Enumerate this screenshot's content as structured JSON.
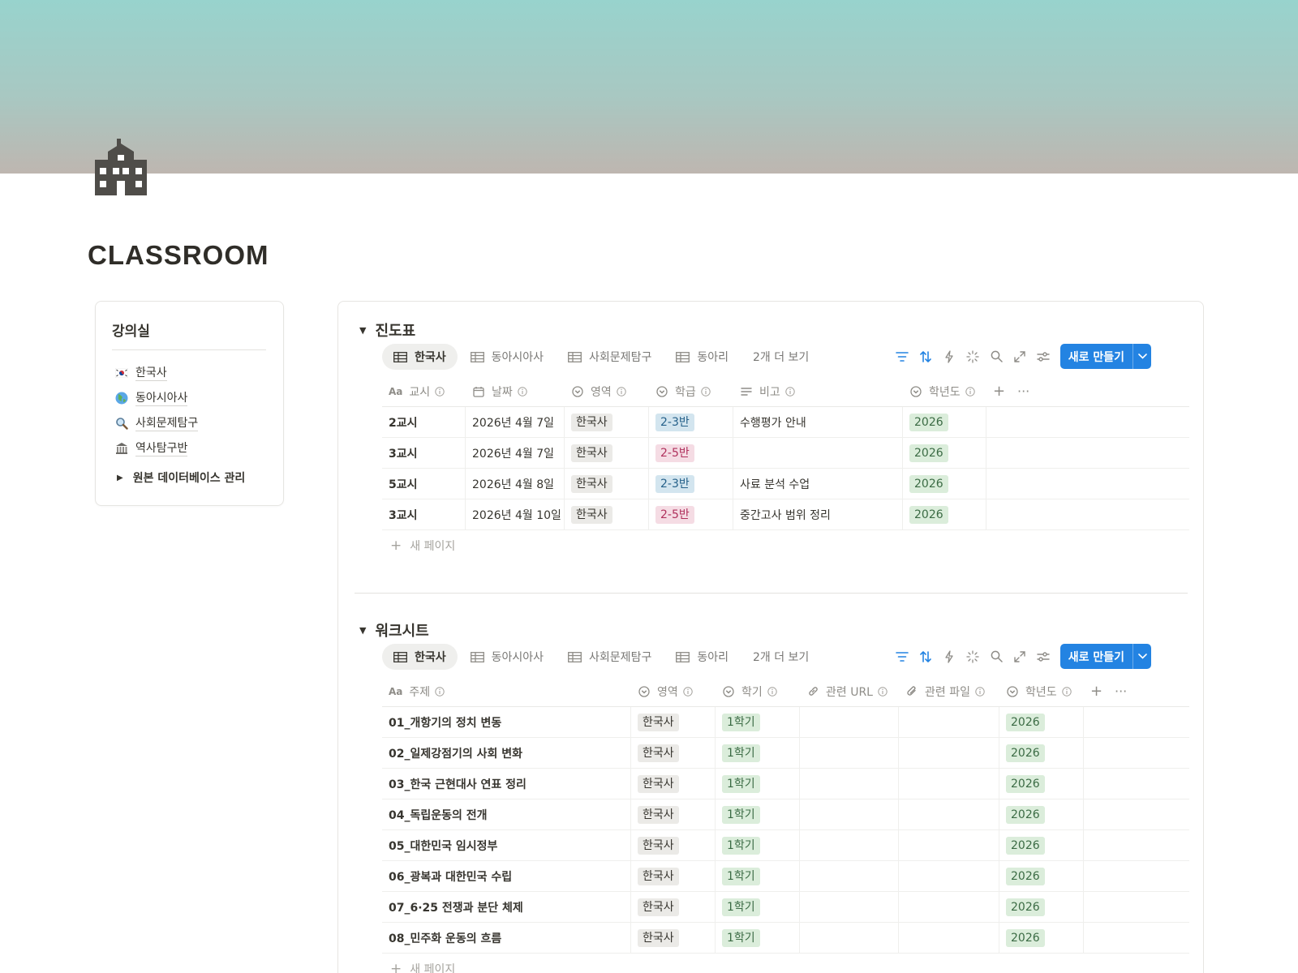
{
  "page": {
    "title": "CLASSROOM"
  },
  "sidebar": {
    "title": "강의실",
    "links": [
      {
        "label": "한국사",
        "icon": "korea-flag-icon"
      },
      {
        "label": "동아시아사",
        "icon": "globe-asia-icon"
      },
      {
        "label": "사회문제탐구",
        "icon": "magnifier-icon"
      },
      {
        "label": "역사탐구반",
        "icon": "classical-building-icon"
      }
    ],
    "toggle_label": "원본 데이터베이스 관리"
  },
  "progress_db": {
    "title": "진도표",
    "tabs": [
      "한국사",
      "동아시아사",
      "사회문제탐구",
      "동아리"
    ],
    "more_tabs": "2개 더 보기",
    "new_button": "새로 만들기",
    "columns": [
      "교시",
      "날짜",
      "영역",
      "학급",
      "비고",
      "학년도"
    ],
    "rows": [
      {
        "period": "2교시",
        "date": "2026년 4월 7일",
        "area": "한국사",
        "class": "2-3반",
        "class_color": "blue",
        "note": "수행평가 안내",
        "year": "2026"
      },
      {
        "period": "3교시",
        "date": "2026년 4월 7일",
        "area": "한국사",
        "class": "2-5반",
        "class_color": "pink",
        "note": "",
        "year": "2026"
      },
      {
        "period": "5교시",
        "date": "2026년 4월 8일",
        "area": "한국사",
        "class": "2-3반",
        "class_color": "blue",
        "note": "사료 분석 수업",
        "year": "2026"
      },
      {
        "period": "3교시",
        "date": "2026년 4월 10일",
        "area": "한국사",
        "class": "2-5반",
        "class_color": "pink",
        "note": "중간고사 범위 정리",
        "year": "2026"
      }
    ],
    "new_page": "새 페이지"
  },
  "worksheet_db": {
    "title": "워크시트",
    "tabs": [
      "한국사",
      "동아시아사",
      "사회문제탐구",
      "동아리"
    ],
    "more_tabs": "2개 더 보기",
    "new_button": "새로 만들기",
    "columns": [
      "주제",
      "영역",
      "학기",
      "관련 URL",
      "관련 파일",
      "학년도"
    ],
    "rows": [
      {
        "topic": "01_개항기의 정치 변동",
        "area": "한국사",
        "term": "1학기",
        "year": "2026"
      },
      {
        "topic": "02_일제강점기의 사회 변화",
        "area": "한국사",
        "term": "1학기",
        "year": "2026"
      },
      {
        "topic": "03_한국 근현대사 연표 정리",
        "area": "한국사",
        "term": "1학기",
        "year": "2026"
      },
      {
        "topic": "04_독립운동의 전개",
        "area": "한국사",
        "term": "1학기",
        "year": "2026"
      },
      {
        "topic": "05_대한민국 임시정부",
        "area": "한국사",
        "term": "1학기",
        "year": "2026"
      },
      {
        "topic": "06_광복과 대한민국 수립",
        "area": "한국사",
        "term": "1학기",
        "year": "2026"
      },
      {
        "topic": "07_6·25 전쟁과 분단 체제",
        "area": "한국사",
        "term": "1학기",
        "year": "2026"
      },
      {
        "topic": "08_민주화 운동의 흐름",
        "area": "한국사",
        "term": "1학기",
        "year": "2026"
      }
    ],
    "new_page": "새 페이지"
  },
  "colors": {
    "accent": "#2383e2",
    "cover_top": "#98d3cd",
    "cover_bottom": "#beb6b0"
  }
}
